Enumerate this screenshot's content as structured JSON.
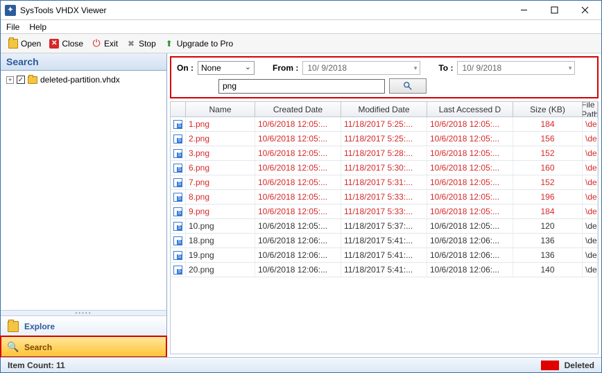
{
  "window": {
    "title": "SysTools VHDX Viewer"
  },
  "menu": {
    "file": "File",
    "help": "Help"
  },
  "toolbar": {
    "open": "Open",
    "close": "Close",
    "exit": "Exit",
    "stop": "Stop",
    "upgrade": "Upgrade to Pro"
  },
  "left": {
    "header": "Search",
    "tree_item": "deleted-partition.vhdx",
    "explore": "Explore",
    "search": "Search"
  },
  "search": {
    "on_label": "On :",
    "on_value": "None",
    "from_label": "From :",
    "from_value": "10/ 9/2018",
    "to_label": "To :",
    "to_value": "10/ 9/2018",
    "term": "png"
  },
  "grid": {
    "headers": [
      "",
      "Name",
      "Created Date",
      "Modified Date",
      "Last Accessed D",
      "Size (KB)",
      "File Path"
    ],
    "rows": [
      {
        "deleted": true,
        "name": "1.png",
        "created": "10/6/2018 12:05:...",
        "modified": "11/18/2017 5:25:...",
        "accessed": "10/6/2018 12:05:...",
        "size": "184",
        "path": "\\deleted-partition.v..."
      },
      {
        "deleted": true,
        "name": "2.png",
        "created": "10/6/2018 12:05:...",
        "modified": "11/18/2017 5:25:...",
        "accessed": "10/6/2018 12:05:...",
        "size": "156",
        "path": "\\deleted-partition.v..."
      },
      {
        "deleted": true,
        "name": "3.png",
        "created": "10/6/2018 12:05:...",
        "modified": "11/18/2017 5:28:...",
        "accessed": "10/6/2018 12:05:...",
        "size": "152",
        "path": "\\deleted-partition.v..."
      },
      {
        "deleted": true,
        "name": "6.png",
        "created": "10/6/2018 12:05:...",
        "modified": "11/18/2017 5:30:...",
        "accessed": "10/6/2018 12:05:...",
        "size": "160",
        "path": "\\deleted-partition.v..."
      },
      {
        "deleted": true,
        "name": "7.png",
        "created": "10/6/2018 12:05:...",
        "modified": "11/18/2017 5:31:...",
        "accessed": "10/6/2018 12:05:...",
        "size": "152",
        "path": "\\deleted-partition.v..."
      },
      {
        "deleted": true,
        "name": "8.png",
        "created": "10/6/2018 12:05:...",
        "modified": "11/18/2017 5:33:...",
        "accessed": "10/6/2018 12:05:...",
        "size": "196",
        "path": "\\deleted-partition.v..."
      },
      {
        "deleted": true,
        "name": "9.png",
        "created": "10/6/2018 12:05:...",
        "modified": "11/18/2017 5:33:...",
        "accessed": "10/6/2018 12:05:...",
        "size": "184",
        "path": "\\deleted-partition.v..."
      },
      {
        "deleted": false,
        "name": "10.png",
        "created": "10/6/2018 12:05:...",
        "modified": "11/18/2017 5:37:...",
        "accessed": "10/6/2018 12:05:...",
        "size": "120",
        "path": "\\deleted-partition.v..."
      },
      {
        "deleted": false,
        "name": "18.png",
        "created": "10/6/2018 12:06:...",
        "modified": "11/18/2017 5:41:...",
        "accessed": "10/6/2018 12:06:...",
        "size": "136",
        "path": "\\deleted-partition.v..."
      },
      {
        "deleted": false,
        "name": "19.png",
        "created": "10/6/2018 12:06:...",
        "modified": "11/18/2017 5:41:...",
        "accessed": "10/6/2018 12:06:...",
        "size": "136",
        "path": "\\deleted-partition.v..."
      },
      {
        "deleted": false,
        "name": "20.png",
        "created": "10/6/2018 12:06:...",
        "modified": "11/18/2017 5:41:...",
        "accessed": "10/6/2018 12:06:...",
        "size": "140",
        "path": "\\deleted-partition.v..."
      }
    ]
  },
  "status": {
    "item_count": "Item Count: 11",
    "deleted_label": "Deleted"
  }
}
